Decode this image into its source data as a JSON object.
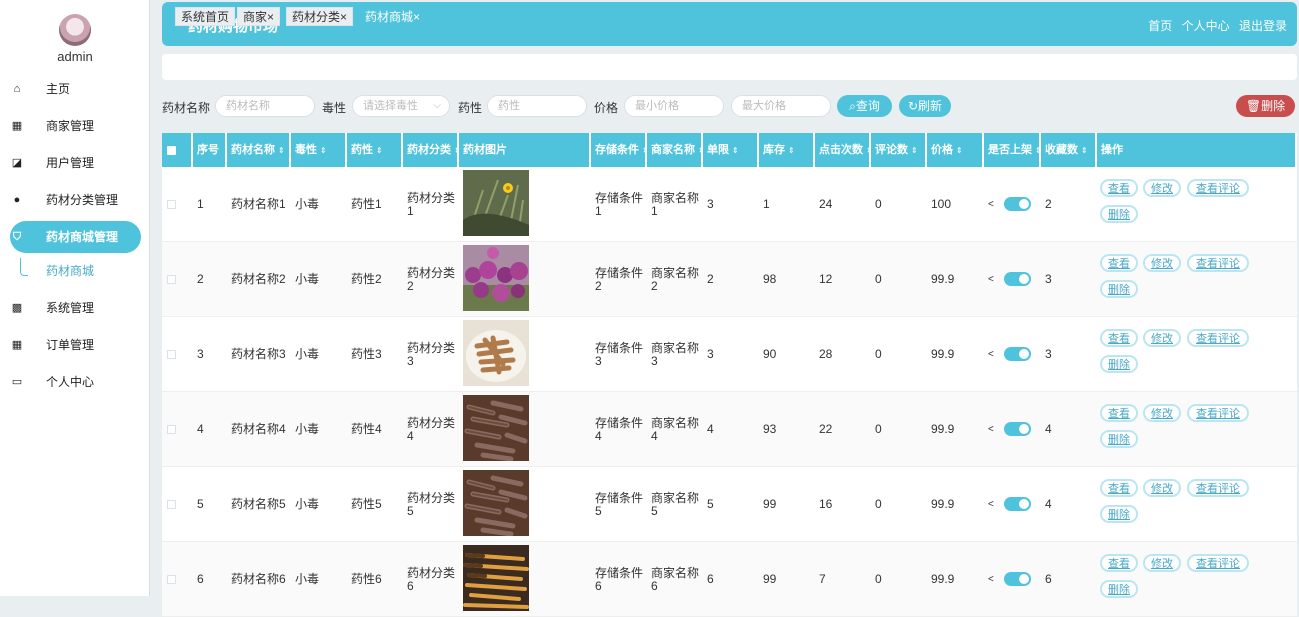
{
  "user": {
    "name": "admin"
  },
  "sidebar": {
    "items": [
      {
        "label": "主页",
        "icon": "home-icon",
        "glyph": "⌂"
      },
      {
        "label": "商家管理",
        "icon": "grid-icon",
        "glyph": "▦"
      },
      {
        "label": "用户管理",
        "icon": "chart-icon",
        "glyph": "◪"
      },
      {
        "label": "药材分类管理",
        "icon": "pin-icon",
        "glyph": "●"
      },
      {
        "label": "药材商城管理",
        "icon": "filter-icon",
        "glyph": "⛉"
      },
      {
        "label": "系统管理",
        "icon": "apps-icon",
        "glyph": "▩"
      },
      {
        "label": "订单管理",
        "icon": "grid-icon",
        "glyph": "▦"
      },
      {
        "label": "个人中心",
        "icon": "card-icon",
        "glyph": "▭"
      }
    ],
    "submenu": "药材商城"
  },
  "header": {
    "title": "药材购物市场",
    "links": [
      "首页",
      "个人中心",
      "退出登录"
    ]
  },
  "tabs": [
    {
      "label": "系统首页"
    },
    {
      "label": "商家×"
    },
    {
      "label": "药材分类×"
    },
    {
      "label": "药材商城×"
    }
  ],
  "filters": {
    "name_label": "药材名称",
    "name_placeholder": "药材名称",
    "toxicity_label": "毒性",
    "toxicity_placeholder": "请选择毒性",
    "nature_label": "药性",
    "nature_placeholder": "药性",
    "price_label": "价格",
    "min_price_placeholder": "最小价格",
    "max_price_placeholder": "最大价格",
    "query_label": "查询",
    "refresh_label": "刷新",
    "delete_label": "删除"
  },
  "table": {
    "headers": [
      "序号",
      "药材名称",
      "毒性",
      "药性",
      "药材分类",
      "药材图片",
      "存储条件",
      "商家名称",
      "单限",
      "库存",
      "点击次数",
      "评论数",
      "价格",
      "是否上架",
      "收藏数",
      "操作"
    ],
    "sortable": [
      false,
      true,
      true,
      true,
      true,
      false,
      true,
      true,
      true,
      true,
      true,
      true,
      true,
      true,
      true,
      false
    ],
    "actions": [
      "查看",
      "修改",
      "查看评论",
      "删除"
    ],
    "rows": [
      {
        "idx": "1",
        "name": "药材名称1",
        "toxicity": "小毒",
        "nature": "药性1",
        "category": "药材分类1",
        "storage": "存储条件1",
        "merchant": "商家名称1",
        "limit": "3",
        "stock": "1",
        "clicks": "24",
        "comments": "0",
        "price": "100",
        "on_shelf": true,
        "favorites": "2",
        "image": "yellow-flower-plant"
      },
      {
        "idx": "2",
        "name": "药材名称2",
        "toxicity": "小毒",
        "nature": "药性2",
        "category": "药材分类2",
        "storage": "存储条件2",
        "merchant": "商家名称2",
        "limit": "2",
        "stock": "98",
        "clicks": "12",
        "comments": "0",
        "price": "99.9",
        "on_shelf": true,
        "favorites": "3",
        "image": "purple-flowers"
      },
      {
        "idx": "3",
        "name": "药材名称3",
        "toxicity": "小毒",
        "nature": "药性3",
        "category": "药材分类3",
        "storage": "存储条件3",
        "merchant": "商家名称3",
        "limit": "3",
        "stock": "90",
        "clicks": "28",
        "comments": "0",
        "price": "99.9",
        "on_shelf": true,
        "favorites": "3",
        "image": "dried-roots-bowl"
      },
      {
        "idx": "4",
        "name": "药材名称4",
        "toxicity": "小毒",
        "nature": "药性4",
        "category": "药材分类4",
        "storage": "存储条件4",
        "merchant": "商家名称4",
        "limit": "4",
        "stock": "93",
        "clicks": "22",
        "comments": "0",
        "price": "99.9",
        "on_shelf": true,
        "favorites": "4",
        "image": "dark-dried-roots"
      },
      {
        "idx": "5",
        "name": "药材名称5",
        "toxicity": "小毒",
        "nature": "药性5",
        "category": "药材分类5",
        "storage": "存储条件5",
        "merchant": "商家名称5",
        "limit": "5",
        "stock": "99",
        "clicks": "16",
        "comments": "0",
        "price": "99.9",
        "on_shelf": true,
        "favorites": "4",
        "image": "dark-dried-roots"
      },
      {
        "idx": "6",
        "name": "药材名称6",
        "toxicity": "小毒",
        "nature": "药性6",
        "category": "药材分类6",
        "storage": "存储条件6",
        "merchant": "商家名称6",
        "limit": "6",
        "stock": "99",
        "clicks": "7",
        "comments": "0",
        "price": "99.9",
        "on_shelf": true,
        "favorites": "6",
        "image": "cordyceps"
      }
    ]
  },
  "colors": {
    "accent": "#4fc3dc",
    "danger": "#c94d4d",
    "link": "#4aa8c6"
  }
}
